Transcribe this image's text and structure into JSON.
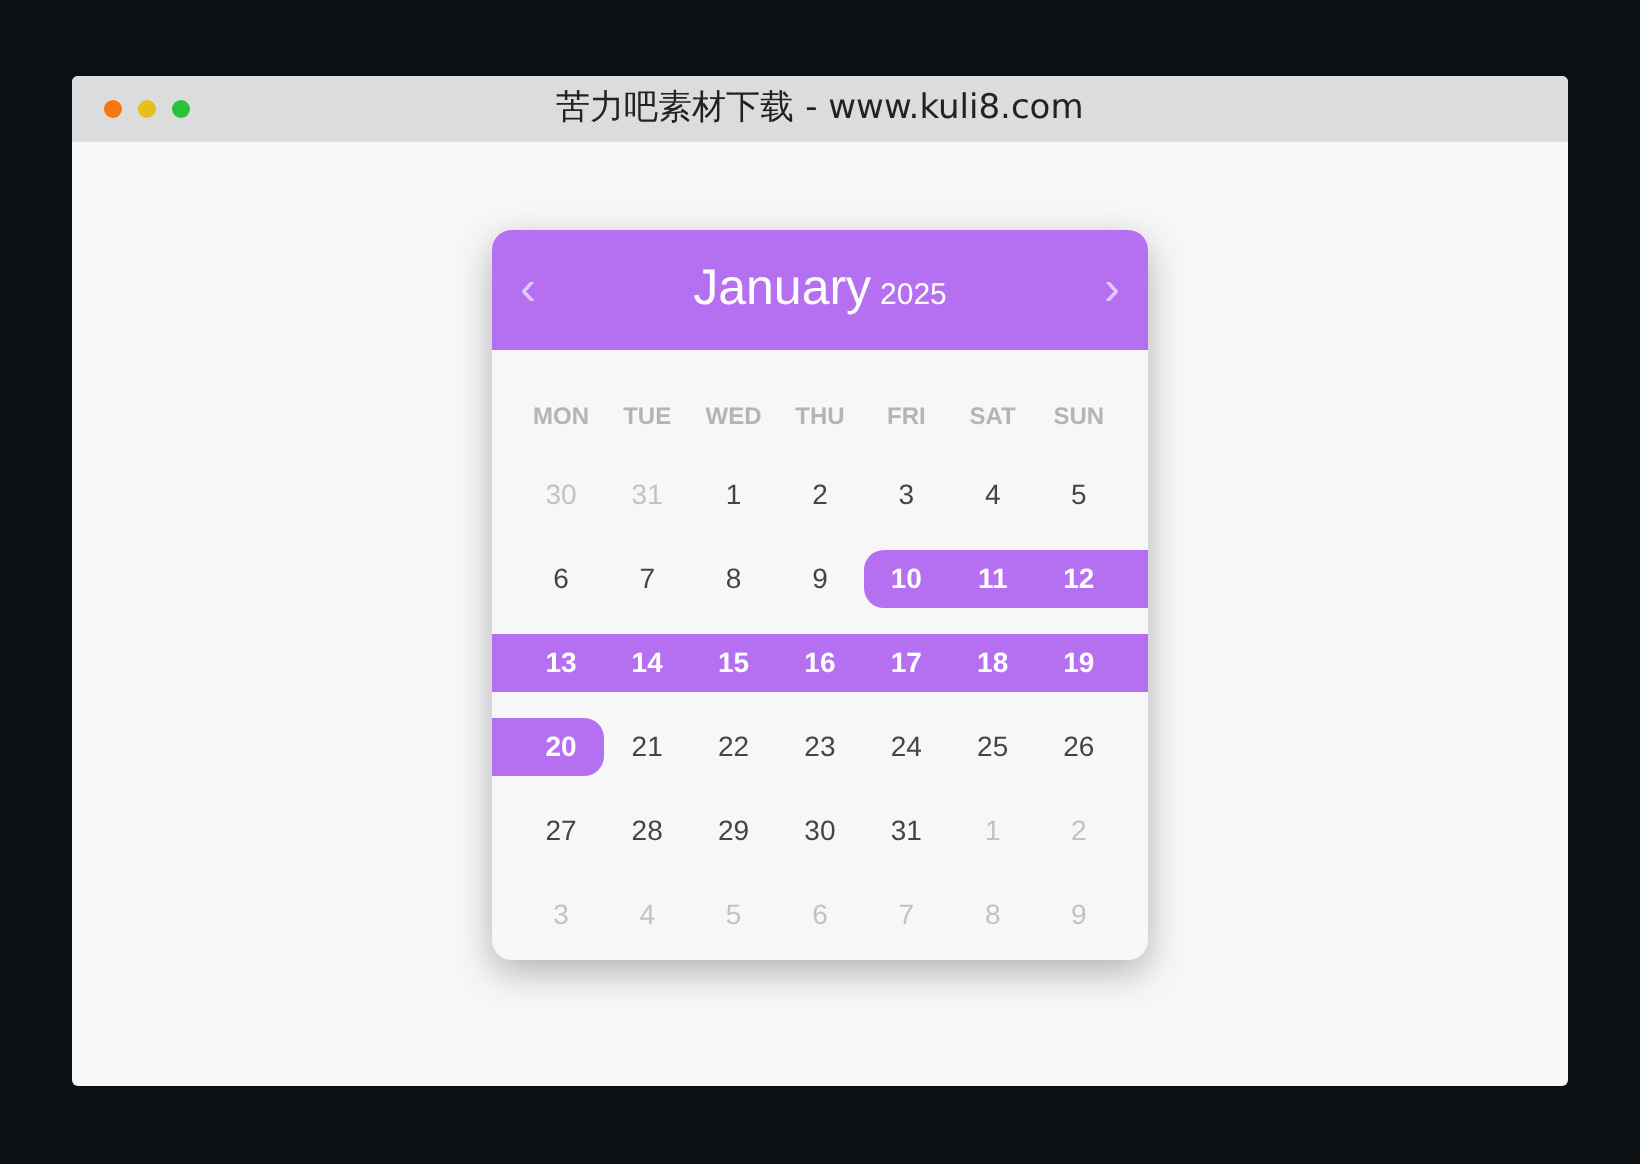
{
  "window": {
    "title": "苦力吧素材下载 - www.kuli8.com"
  },
  "calendar": {
    "prev": "‹",
    "month": "January",
    "year": "2025",
    "next": "›",
    "weekdays": [
      "MON",
      "TUE",
      "WED",
      "THU",
      "FRI",
      "SAT",
      "SUN"
    ],
    "weeks": [
      [
        {
          "day": "30",
          "muted": true,
          "selected": false
        },
        {
          "day": "31",
          "muted": true,
          "selected": false
        },
        {
          "day": "1",
          "muted": false,
          "selected": false
        },
        {
          "day": "2",
          "muted": false,
          "selected": false
        },
        {
          "day": "3",
          "muted": false,
          "selected": false
        },
        {
          "day": "4",
          "muted": false,
          "selected": false
        },
        {
          "day": "5",
          "muted": false,
          "selected": false
        }
      ],
      [
        {
          "day": "6",
          "muted": false,
          "selected": false
        },
        {
          "day": "7",
          "muted": false,
          "selected": false
        },
        {
          "day": "8",
          "muted": false,
          "selected": false
        },
        {
          "day": "9",
          "muted": false,
          "selected": false
        },
        {
          "day": "10",
          "muted": false,
          "selected": true
        },
        {
          "day": "11",
          "muted": false,
          "selected": true
        },
        {
          "day": "12",
          "muted": false,
          "selected": true
        }
      ],
      [
        {
          "day": "13",
          "muted": false,
          "selected": true
        },
        {
          "day": "14",
          "muted": false,
          "selected": true
        },
        {
          "day": "15",
          "muted": false,
          "selected": true
        },
        {
          "day": "16",
          "muted": false,
          "selected": true
        },
        {
          "day": "17",
          "muted": false,
          "selected": true
        },
        {
          "day": "18",
          "muted": false,
          "selected": true
        },
        {
          "day": "19",
          "muted": false,
          "selected": true
        }
      ],
      [
        {
          "day": "20",
          "muted": false,
          "selected": true
        },
        {
          "day": "21",
          "muted": false,
          "selected": false
        },
        {
          "day": "22",
          "muted": false,
          "selected": false
        },
        {
          "day": "23",
          "muted": false,
          "selected": false
        },
        {
          "day": "24",
          "muted": false,
          "selected": false
        },
        {
          "day": "25",
          "muted": false,
          "selected": false
        },
        {
          "day": "26",
          "muted": false,
          "selected": false
        }
      ],
      [
        {
          "day": "27",
          "muted": false,
          "selected": false
        },
        {
          "day": "28",
          "muted": false,
          "selected": false
        },
        {
          "day": "29",
          "muted": false,
          "selected": false
        },
        {
          "day": "30",
          "muted": false,
          "selected": false
        },
        {
          "day": "31",
          "muted": false,
          "selected": false
        },
        {
          "day": "1",
          "muted": true,
          "selected": false
        },
        {
          "day": "2",
          "muted": true,
          "selected": false
        }
      ],
      [
        {
          "day": "3",
          "muted": true,
          "selected": false
        },
        {
          "day": "4",
          "muted": true,
          "selected": false
        },
        {
          "day": "5",
          "muted": true,
          "selected": false
        },
        {
          "day": "6",
          "muted": true,
          "selected": false
        },
        {
          "day": "7",
          "muted": true,
          "selected": false
        },
        {
          "day": "8",
          "muted": true,
          "selected": false
        },
        {
          "day": "9",
          "muted": true,
          "selected": false
        }
      ]
    ]
  }
}
